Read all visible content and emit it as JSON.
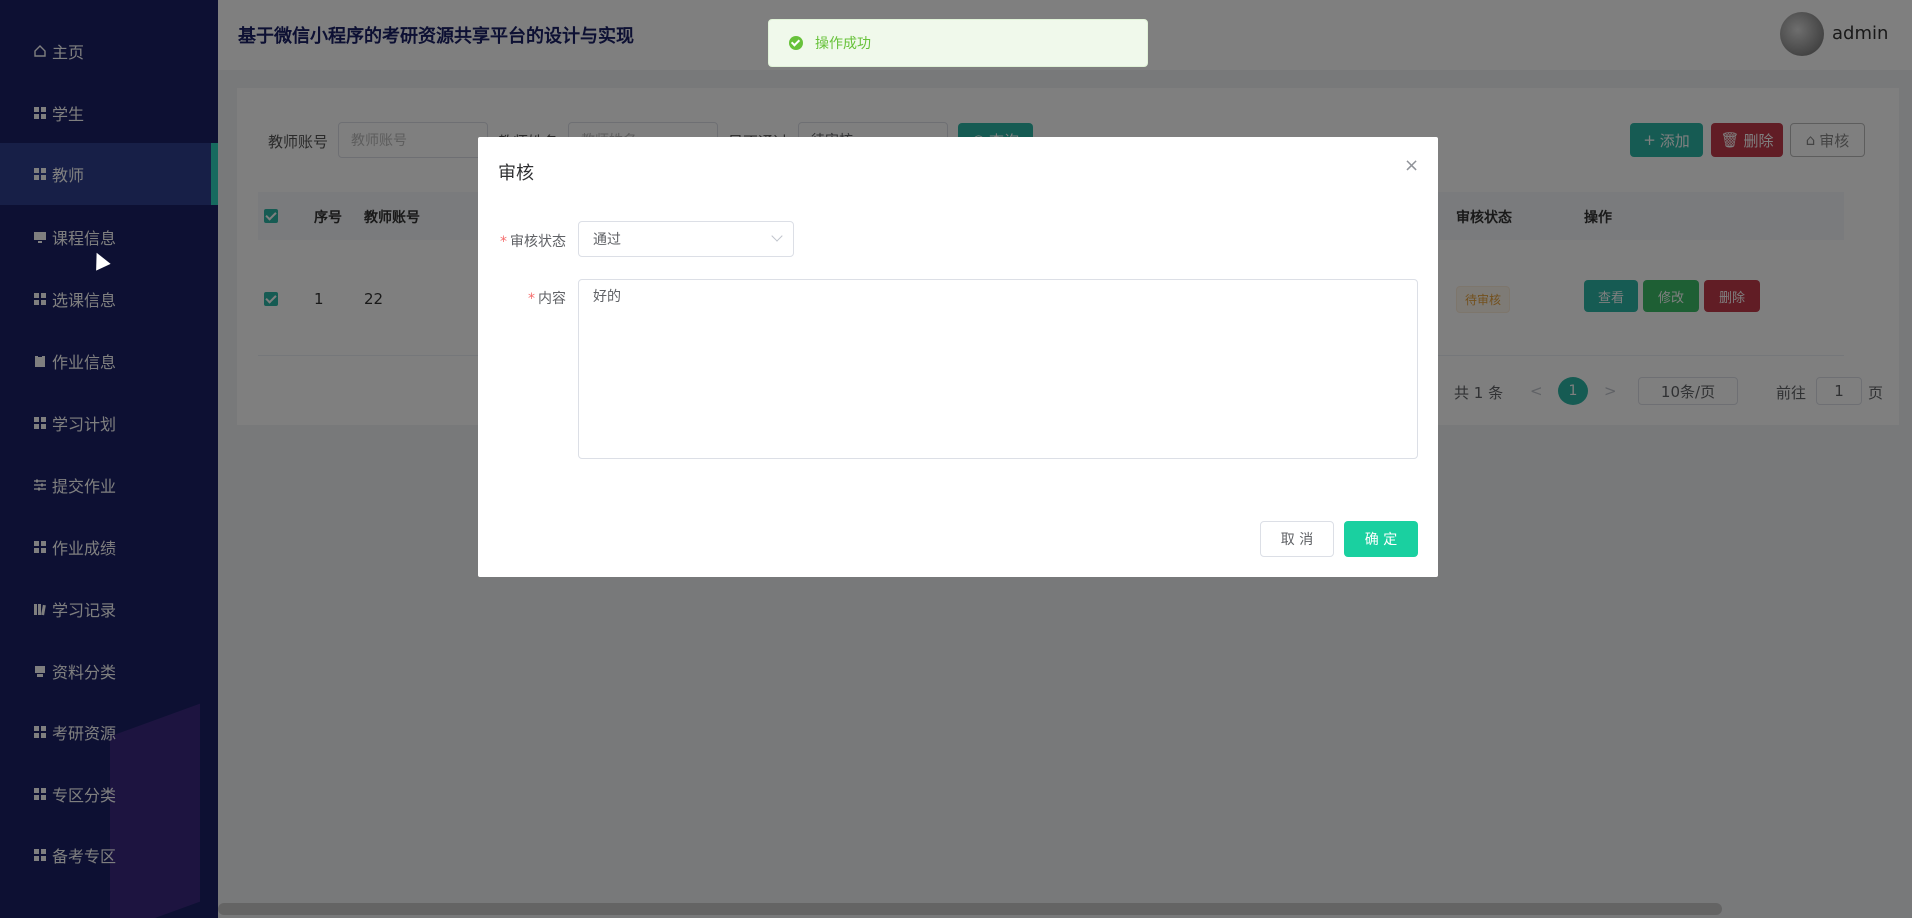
{
  "app": {
    "title": "基于微信小程序的考研资源共享平台的设计与实现",
    "username": "admin"
  },
  "sidebar": {
    "items": [
      {
        "label": "主页",
        "icon": "home-icon",
        "active": false
      },
      {
        "label": "学生",
        "icon": "grid-icon",
        "active": false
      },
      {
        "label": "教师",
        "icon": "grid-icon",
        "active": true
      },
      {
        "label": "课程信息",
        "icon": "monitor-icon",
        "active": false
      },
      {
        "label": "选课信息",
        "icon": "grid-icon",
        "active": false
      },
      {
        "label": "作业信息",
        "icon": "clipboard-icon",
        "active": false
      },
      {
        "label": "学习计划",
        "icon": "grid-icon",
        "active": false
      },
      {
        "label": "提交作业",
        "icon": "sliders-icon",
        "active": false
      },
      {
        "label": "作业成绩",
        "icon": "grid-icon",
        "active": false
      },
      {
        "label": "学习记录",
        "icon": "book-icon",
        "active": false
      },
      {
        "label": "资料分类",
        "icon": "printer-icon",
        "active": false
      },
      {
        "label": "考研资源",
        "icon": "grid-icon",
        "active": false
      },
      {
        "label": "专区分类",
        "icon": "grid-icon",
        "active": false
      },
      {
        "label": "备考专区",
        "icon": "grid-icon",
        "active": false
      }
    ]
  },
  "filters": {
    "account_label": "教师账号",
    "account_placeholder": "教师账号",
    "name_label": "教师姓名",
    "name_placeholder": "教师姓名",
    "pass_label": "是否通过",
    "pass_value": "待审核",
    "query_label": "查询"
  },
  "toolbar": {
    "add_label": "添加",
    "delete_label": "删除",
    "audit_label": "审核"
  },
  "table": {
    "headers": {
      "index": "序号",
      "account": "教师账号",
      "status": "审核状态",
      "actions": "操作"
    },
    "rows": [
      {
        "index": "1",
        "account": "22",
        "status": "待审核"
      }
    ],
    "row_actions": {
      "view": "查看",
      "edit": "修改",
      "delete": "删除"
    }
  },
  "pagination": {
    "total": "共 1 条",
    "prev": "<",
    "page": "1",
    "next": ">",
    "size": "10条/页",
    "goto_prefix": "前往",
    "goto_value": "1",
    "goto_suffix": "页"
  },
  "toast": {
    "message": "操作成功"
  },
  "dialog": {
    "title": "审核",
    "close": "×",
    "status_label": "审核状态",
    "status_value": "通过",
    "content_label": "内容",
    "content_value": "好的",
    "cancel_label": "取 消",
    "ok_label": "确 定"
  },
  "colors": {
    "sidebar_bg": "#1a2066",
    "accent": "#2db7a6",
    "danger": "#c23a4a",
    "success": "#67c23a",
    "confirm": "#1ad0a0"
  }
}
